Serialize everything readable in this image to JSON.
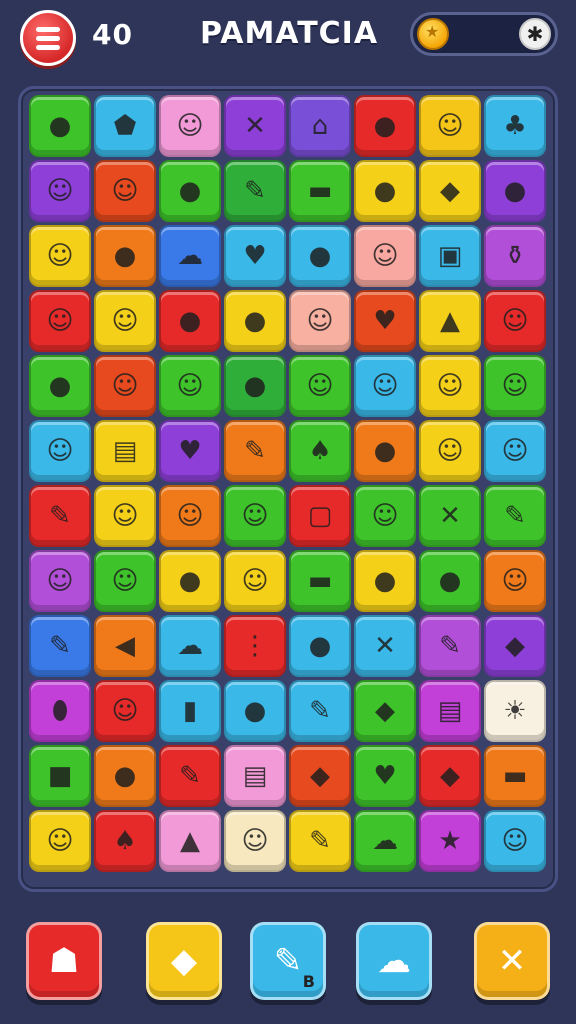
{
  "header": {
    "score": "40",
    "title": "PAMATCIA",
    "coin_icon": "star-coin-icon",
    "add_icon": "asterisk-icon"
  },
  "board": {
    "rows": [
      [
        {
          "c": "#3ec42a",
          "g": "●"
        },
        {
          "c": "#3ab8e8",
          "g": "⬟"
        },
        {
          "c": "#f29ad8",
          "g": "☺"
        },
        {
          "c": "#8e3fd8",
          "g": "✕"
        },
        {
          "c": "#7a4fd8",
          "g": "⌂"
        },
        {
          "c": "#e62a2a",
          "g": "●"
        },
        {
          "c": "#f5c518",
          "g": "☺"
        },
        {
          "c": "#3ab8e8",
          "g": "♣"
        }
      ],
      [
        {
          "c": "#8e3fd8",
          "g": "☺"
        },
        {
          "c": "#e64a1e",
          "g": "☺"
        },
        {
          "c": "#3ec42a",
          "g": "●"
        },
        {
          "c": "#2fae3a",
          "g": "✎"
        },
        {
          "c": "#3ec42a",
          "g": "▬"
        },
        {
          "c": "#f5d018",
          "g": "●"
        },
        {
          "c": "#f5d018",
          "g": "◆"
        },
        {
          "c": "#8e3fd8",
          "g": "●"
        }
      ],
      [
        {
          "c": "#f5d018",
          "g": "☺"
        },
        {
          "c": "#f07a1a",
          "g": "●"
        },
        {
          "c": "#3a7ae8",
          "g": "☁"
        },
        {
          "c": "#3ab8e8",
          "g": "♥"
        },
        {
          "c": "#3ab8e8",
          "g": "●"
        },
        {
          "c": "#f8a8a0",
          "g": "☺"
        },
        {
          "c": "#3ab8e8",
          "g": "▣"
        },
        {
          "c": "#b24fd8",
          "g": "⚱"
        }
      ],
      [
        {
          "c": "#e62a2a",
          "g": "☺"
        },
        {
          "c": "#f5d018",
          "g": "☺"
        },
        {
          "c": "#e62a2a",
          "g": "●"
        },
        {
          "c": "#f5d018",
          "g": "●"
        },
        {
          "c": "#f8b0a0",
          "g": "☺"
        },
        {
          "c": "#e64a1e",
          "g": "♥"
        },
        {
          "c": "#f5d018",
          "g": "▲"
        },
        {
          "c": "#e62a2a",
          "g": "☺"
        }
      ],
      [
        {
          "c": "#3ec42a",
          "g": "●"
        },
        {
          "c": "#e64a1e",
          "g": "☺"
        },
        {
          "c": "#3ec42a",
          "g": "☺"
        },
        {
          "c": "#2fae3a",
          "g": "●"
        },
        {
          "c": "#3ec42a",
          "g": "☺"
        },
        {
          "c": "#3ab8e8",
          "g": "☺"
        },
        {
          "c": "#f5d018",
          "g": "☺"
        },
        {
          "c": "#3ec42a",
          "g": "☺"
        }
      ],
      [
        {
          "c": "#3ab8e8",
          "g": "☺"
        },
        {
          "c": "#f5d018",
          "g": "▤"
        },
        {
          "c": "#8e3fd8",
          "g": "♥"
        },
        {
          "c": "#f07a1a",
          "g": "✎"
        },
        {
          "c": "#3ec42a",
          "g": "♠"
        },
        {
          "c": "#f07a1a",
          "g": "●"
        },
        {
          "c": "#f5d018",
          "g": "☺"
        },
        {
          "c": "#3ab8e8",
          "g": "☺"
        }
      ],
      [
        {
          "c": "#e62a2a",
          "g": "✎"
        },
        {
          "c": "#f5d018",
          "g": "☺"
        },
        {
          "c": "#f07a1a",
          "g": "☺"
        },
        {
          "c": "#3ec42a",
          "g": "☺"
        },
        {
          "c": "#e62a2a",
          "g": "▢"
        },
        {
          "c": "#3ec42a",
          "g": "☺"
        },
        {
          "c": "#3ec42a",
          "g": "✕"
        },
        {
          "c": "#3ec42a",
          "g": "✎"
        }
      ],
      [
        {
          "c": "#b24fd8",
          "g": "☺"
        },
        {
          "c": "#3ec42a",
          "g": "☺"
        },
        {
          "c": "#f5d018",
          "g": "●"
        },
        {
          "c": "#f5d018",
          "g": "☺"
        },
        {
          "c": "#3ec42a",
          "g": "▬"
        },
        {
          "c": "#f5d018",
          "g": "●"
        },
        {
          "c": "#3ec42a",
          "g": "●"
        },
        {
          "c": "#f07a1a",
          "g": "☺"
        }
      ],
      [
        {
          "c": "#3a7ae8",
          "g": "✎"
        },
        {
          "c": "#f07a1a",
          "g": "◀"
        },
        {
          "c": "#3ab8e8",
          "g": "☁"
        },
        {
          "c": "#e62a2a",
          "g": "⋮"
        },
        {
          "c": "#3ab8e8",
          "g": "●"
        },
        {
          "c": "#3ab8e8",
          "g": "✕"
        },
        {
          "c": "#b24fd8",
          "g": "✎"
        },
        {
          "c": "#8e3fd8",
          "g": "◆"
        }
      ],
      [
        {
          "c": "#c23fd8",
          "g": "⬮"
        },
        {
          "c": "#e62a2a",
          "g": "☺"
        },
        {
          "c": "#3ab8e8",
          "g": "▮"
        },
        {
          "c": "#3ab8e8",
          "g": "●"
        },
        {
          "c": "#3ab8e8",
          "g": "✎"
        },
        {
          "c": "#3ec42a",
          "g": "◆"
        },
        {
          "c": "#c23fd8",
          "g": "▤"
        },
        {
          "c": "#f8f0e0",
          "g": "☀"
        }
      ],
      [
        {
          "c": "#3ec42a",
          "g": "■"
        },
        {
          "c": "#f07a1a",
          "g": "●"
        },
        {
          "c": "#e62a2a",
          "g": "✎"
        },
        {
          "c": "#f29ad8",
          "g": "▤"
        },
        {
          "c": "#e64a1e",
          "g": "◆"
        },
        {
          "c": "#3ec42a",
          "g": "♥"
        },
        {
          "c": "#e62a2a",
          "g": "◆"
        },
        {
          "c": "#f07a1a",
          "g": "▬"
        }
      ],
      [
        {
          "c": "#f5d018",
          "g": "☺"
        },
        {
          "c": "#e62a2a",
          "g": "♠"
        },
        {
          "c": "#f29ad8",
          "g": "▲"
        },
        {
          "c": "#f8e8c0",
          "g": "☺"
        },
        {
          "c": "#f5d018",
          "g": "✎"
        },
        {
          "c": "#3ec42a",
          "g": "☁"
        },
        {
          "c": "#c23fd8",
          "g": "★"
        },
        {
          "c": "#3ab8e8",
          "g": "☺"
        }
      ]
    ]
  },
  "dock": {
    "tools": [
      {
        "name": "tool-ghost-button",
        "color": "#e62a2a",
        "glyph": "☗",
        "label": ""
      },
      {
        "name": "tool-shard-button",
        "color": "#f5c518",
        "glyph": "◆",
        "label": ""
      },
      {
        "name": "tool-pencil-button",
        "color": "#3ab8e8",
        "glyph": "✎",
        "label": "B"
      },
      {
        "name": "tool-cloud-button",
        "color": "#3ab8e8",
        "glyph": "☁",
        "label": ""
      },
      {
        "name": "tool-crossed-tools-button",
        "color": "#f5b018",
        "glyph": "✕",
        "label": ""
      }
    ]
  }
}
